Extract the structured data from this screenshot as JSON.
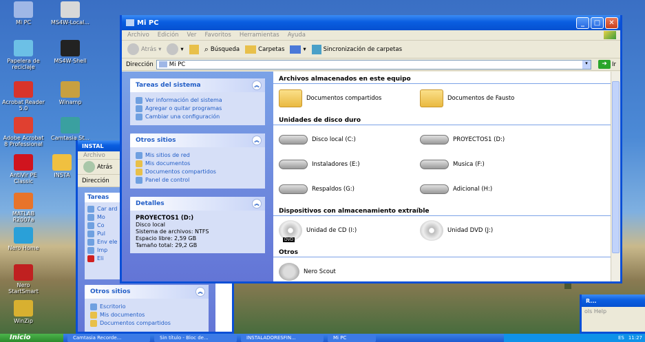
{
  "desktop": {
    "icons": [
      {
        "label": "Mi PC"
      },
      {
        "label": "MS4W-Local..."
      },
      {
        "label": "Papelera de reciclaje"
      },
      {
        "label": "MS4W-Shell"
      },
      {
        "label": "Acrobat Reader 5.0"
      },
      {
        "label": "Winamp"
      },
      {
        "label": "Adobe Acrobat 8 Professional"
      },
      {
        "label": "Camtasia St..."
      },
      {
        "label": "AntiVir PE Classic"
      },
      {
        "label": "INSTA"
      },
      {
        "label": "MATLAB R2007a"
      },
      {
        "label": "Nero Home"
      },
      {
        "label": "Nero StartSmart"
      },
      {
        "label": "WinZip"
      }
    ]
  },
  "back_window": {
    "title": "INSTAL",
    "menu_first": "Archivo",
    "back_label": "Atrás",
    "address_label": "Dirección",
    "tasks_title": "Tareas",
    "task_items": [
      "Car ard",
      "Mo",
      "Co",
      "Pul",
      "Env ele",
      "Imp",
      "Eli"
    ],
    "otros_sitios": {
      "title": "Otros sitios",
      "items": [
        "Escritorio",
        "Mis documentos",
        "Documentos compartidos"
      ]
    }
  },
  "back_right_window": {
    "title": "R...",
    "menu": "ols  Help"
  },
  "main_window": {
    "title": "Mi PC",
    "menu": [
      "Archivo",
      "Edición",
      "Ver",
      "Favoritos",
      "Herramientas",
      "Ayuda"
    ],
    "toolbar": {
      "back": "Atrás",
      "search": "Búsqueda",
      "folders": "Carpetas",
      "sync": "Sincronización de carpetas"
    },
    "address": {
      "label": "Dirección",
      "value": "Mi PC",
      "go": "Ir"
    },
    "tasks": {
      "title": "Tareas del sistema",
      "items": [
        "Ver información del sistema",
        "Agregar o quitar programas",
        "Cambiar una configuración"
      ]
    },
    "otros": {
      "title": "Otros sitios",
      "items": [
        "Mis sitios de red",
        "Mis documentos",
        "Documentos compartidos",
        "Panel de control"
      ]
    },
    "details": {
      "title": "Detalles",
      "name": "PROYECTOS1 (D:)",
      "type": "Disco local",
      "fs": "Sistema de archivos: NTFS",
      "free": "Espacio libre: 2,59 GB",
      "total": "Tamaño total: 29,2 GB"
    },
    "groups": {
      "stored": {
        "title": "Archivos almacenados en este equipo",
        "items": [
          "Documentos compartidos",
          "Documentos de Fausto"
        ]
      },
      "disks": {
        "title": "Unidades de disco duro",
        "items": [
          "Disco local (C:)",
          "PROYECTOS1 (D:)",
          "Instaladores (E:)",
          "Musica (F:)",
          "Respaldos (G:)",
          "Adicional (H:)"
        ]
      },
      "removable": {
        "title": "Dispositivos con almacenamiento extraíble",
        "items": [
          "Unidad de CD (I:)",
          "Unidad DVD (J:)"
        ],
        "dvd_tag": "DVD"
      },
      "others": {
        "title": "Otros",
        "items": [
          "Nero Scout"
        ]
      }
    }
  },
  "taskbar": {
    "start": "Inicio",
    "tasks": [
      "Camtasia Recorde...",
      "Sin título - Bloc de...",
      "INSTALADORESFIN...",
      "Mi PC"
    ],
    "lang": "ES",
    "clock": "11:27"
  }
}
